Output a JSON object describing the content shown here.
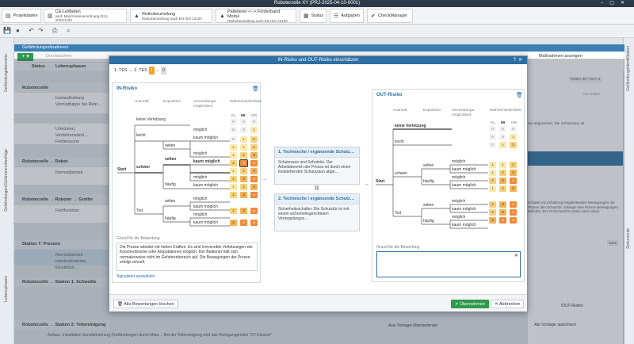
{
  "app": {
    "title": "Roboterzelle XY (PRJ-2025-04-10-0001)"
  },
  "ribbon": {
    "tabs": [
      {
        "label": "Projektdaten",
        "sub": ""
      },
      {
        "label": "CE-Leitfaden",
        "sub": "nach Maschinenverordnung (EU) 2023/1230"
      },
      {
        "label": "Risikobeurteilung",
        "sub": "Risikobeurteilung nach EN ISO 12100"
      },
      {
        "label": "Palletierer <--> Förderband Modul",
        "sub": "Risikobeurteilung nach EN ISO 12100"
      },
      {
        "label": "Status",
        "sub": ""
      },
      {
        "label": "Aufgaben",
        "sub": ""
      },
      {
        "label": "CheckManager",
        "sub": ""
      }
    ]
  },
  "sidestrips": {
    "left": [
      "Gefährdungsbereiche",
      "Gefährdungen/Gefahrenreihenfolge",
      "Lebensphasen"
    ],
    "right": [
      "Gefährdungsidentifikation",
      "Dokumente"
    ]
  },
  "background": {
    "panel_title": "Gefährdungssituationen",
    "search_placeholder": "Durchsuchen",
    "columns": [
      "Status",
      "Lebensphasen"
    ],
    "groups": [
      {
        "label": "Roboterzelle",
        "items": [
          "Instandhaltung",
          "Vorrüstfuppe bei Rein…",
          "Umrüsten, Verfahrensänd…",
          "Fehlersuche"
        ]
      },
      {
        "label": "Roboterzelle → Robot",
        "items": [
          "Normalbetrieb",
          "Reinigung"
        ]
      },
      {
        "label": "Roboterzelle → Roboter → Greifer",
        "items": [
          "Fehlfunktion"
        ]
      },
      {
        "label": "Station 7: Pressen",
        "items": [
          "Normalbetrieb",
          "Inbetriebnahme, Einstellun…"
        ]
      },
      {
        "label": "Roboterzelle → Station 1: Schweiße",
        "items": [
          "Fehlfunktion",
          "Teachen, Programmierung…",
          "Fehlersuche"
        ]
      },
      {
        "label": "Roboterzelle → Station 2: Teilereinigung",
        "items": [
          "Aufbau, Installation",
          "Fehlfunktion"
        ]
      }
    ],
    "bottom_texts": [
      "Sensibilisierung (Gefährdungen durch Mate…",
      "Bei der Teilereinigung wird das Reinigungsmittel \"ZY-Cleaner\""
    ],
    "right_panel": {
      "toggle_label": "Maßnahmen anzeigen",
      "risk_tag": "Risiko IN / OUT 3",
      "ok_label": "OK Risiko",
      "text1": "ren abgesichert. Der Schutzzaun ist",
      "text2": "schaltet mit Zuhaltung eingeleitenden Bewegungen der Presse den Schutztür, solange eine Presse Bewegungen befindet. Ein Tür/Schutztür sowie nach einem",
      "save_label": "Save",
      "vorlage_label": "Aus Vorlage übernehmen",
      "speichern_label": "Als Vorlage speichern",
      "out_risk_label": "OUT-Risiko"
    }
  },
  "modal": {
    "title": "IN-Risiko und OUT-Risiko einschätzen",
    "breadcrumb": {
      "prefix": "1. TES → 2. TES",
      "current": "1",
      "arrow": "→",
      "next": "0"
    },
    "in_risk": {
      "title": "IN-Risiko",
      "col_headers": [
        "Ausmaß",
        "Exposition",
        "Vermeidungs-möglichkeit",
        "Wahrscheinlichkeit"
      ],
      "prob_cols": [
        "KL",
        "MI",
        "GR"
      ],
      "tree_labels": [
        "keine Verletzung",
        "leicht",
        "schwer",
        "Tod",
        "selten",
        "häufig",
        "selten",
        "häufig",
        "Start"
      ],
      "avoid": [
        "möglich",
        "kaum möglich",
        "möglich",
        "kaum möglich",
        "möglich",
        "kaum möglich",
        "möglich",
        "kaum möglich",
        "möglich",
        "kaum möglich"
      ],
      "cells": [
        [
          "0",
          "0",
          "0"
        ],
        [
          "0",
          "0",
          "1"
        ],
        [
          "0",
          "1",
          "2"
        ],
        [
          "1",
          "1",
          "2"
        ],
        [
          "1",
          "2",
          "3"
        ],
        [
          "2",
          "3",
          "4"
        ],
        [
          "1",
          "2",
          "3"
        ],
        [
          "2",
          "3",
          "4"
        ],
        [
          "1",
          "2",
          "3"
        ],
        [
          "2",
          "3",
          "4"
        ],
        [
          "2",
          "3",
          "4"
        ],
        [
          "3",
          "4",
          "4"
        ]
      ],
      "reason_label": "Grund für die Bewertung",
      "reason_text": "Die Presse arbeitet mit hohen Kräften. Es sind irreversible Verletzungen wie Knochenbrüche oder Amputationen möglich. Der Bediener hält sich normalerweise nicht im Gefahrenbereich auf. Die Bewegungen der Presse erfolgt schnell.",
      "keyword_link": "Signalwort auswählen"
    },
    "measures": [
      {
        "title": "1. Technische / ergänzende Schutz…",
        "body": "Schutzzaun und Schutztür. Der Arbeitsbereich der Presse ist durch einen feststehenden Schutzzaun abge…"
      },
      {
        "title": "2. Technische / ergänzende Schutz…",
        "body": "Sicherheitsschalter. Die Schutztür ist mit einem sicherheitsgerichteten Verriegelungss…"
      }
    ],
    "out_risk": {
      "title": "OUT-Risiko",
      "col_headers": [
        "Ausmaß",
        "Exposition",
        "Vermeidungs-möglichkeit",
        "Wahrscheinlichkeit"
      ],
      "prob_cols": [
        "KL",
        "MI",
        "GR"
      ],
      "tree_labels": [
        "keine Verletzung",
        "leicht",
        "schwer",
        "Tod",
        "selten",
        "häufig",
        "selten",
        "häufig",
        "Start"
      ],
      "avoid": [
        "möglich",
        "kaum möglich",
        "möglich",
        "kaum möglich",
        "möglich",
        "kaum möglich",
        "möglich",
        "kaum möglich"
      ],
      "cells": [
        [
          "0",
          "0",
          "0"
        ],
        [
          "0",
          "0",
          "1"
        ],
        [
          "0",
          "1",
          "2"
        ],
        [
          "1",
          "1",
          "2"
        ],
        [
          "1",
          "2",
          "3"
        ],
        [
          "2",
          "3",
          "4"
        ],
        [
          "1",
          "2",
          "3"
        ],
        [
          "2",
          "3",
          "4"
        ],
        [
          "2",
          "3",
          "4"
        ],
        [
          "3",
          "4",
          "4"
        ]
      ],
      "reason_label": "Grund für die Bewertung",
      "reason_text": ""
    },
    "footer": {
      "delete_label": "Alle Bewertungen löschen",
      "accept_label": "Übernehmen",
      "cancel_label": "Abbrechen"
    }
  }
}
